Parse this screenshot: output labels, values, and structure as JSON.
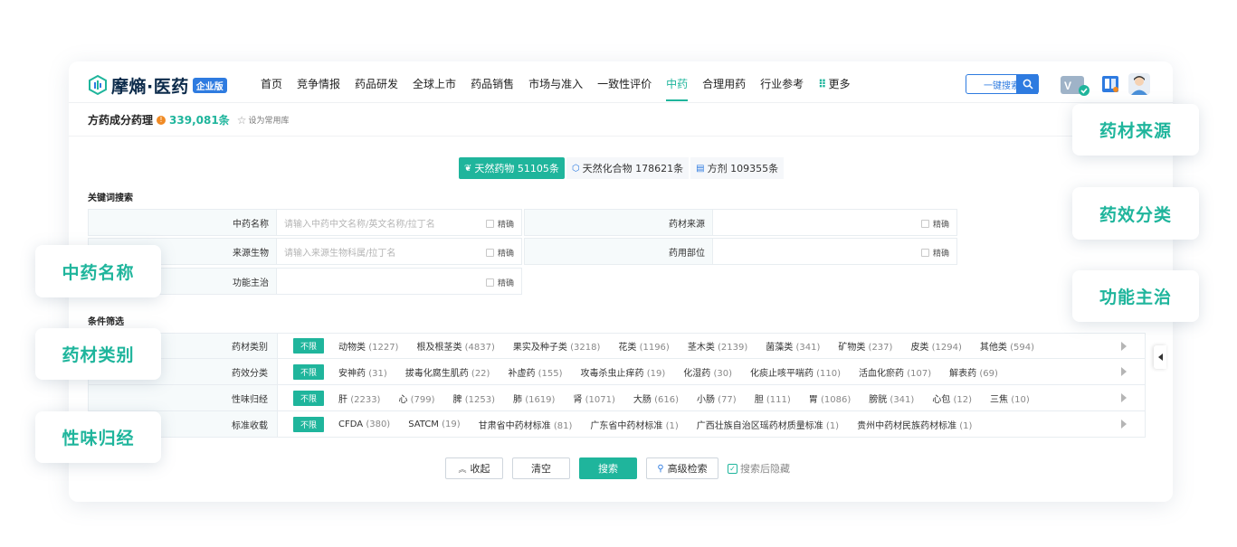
{
  "brand": {
    "name": "摩熵·医药",
    "badge": "企业版"
  },
  "nav": {
    "items": [
      "首页",
      "竞争情报",
      "药品研发",
      "全球上市",
      "药品销售",
      "市场与准入",
      "一致性评价",
      "中药",
      "合理用药",
      "行业参考"
    ],
    "active_index": 7,
    "more_label": "更多"
  },
  "header_search": {
    "label": "一键搜索"
  },
  "page": {
    "title": "方药成分药理",
    "count": "339,081条",
    "favorite_label": "设为常用库"
  },
  "tabs": [
    {
      "label": "天然药物 51105条",
      "active": true
    },
    {
      "label": "天然化合物 178621条",
      "active": false
    },
    {
      "label": "方剂 109355条",
      "active": false
    }
  ],
  "keyword_section": {
    "title": "关键词搜索",
    "exact_label": "精确",
    "fields": {
      "tcm_name": {
        "label": "中药名称",
        "placeholder": "请输入中药中文名称/英文名称/拉丁名"
      },
      "herb_source": {
        "label": "药材来源",
        "placeholder": ""
      },
      "source_organism": {
        "label": "来源生物",
        "placeholder": "请输入来源生物科属/拉丁名"
      },
      "medicinal_part": {
        "label": "药用部位",
        "placeholder": ""
      },
      "function": {
        "label": "功能主治",
        "placeholder": ""
      }
    }
  },
  "filter_section": {
    "title": "条件筛选",
    "unlimited_label": "不限",
    "rows": [
      {
        "label": "药材类别",
        "items": [
          {
            "name": "动物类",
            "count": "(1227)"
          },
          {
            "name": "根及根茎类",
            "count": "(4837)"
          },
          {
            "name": "果实及种子类",
            "count": "(3218)"
          },
          {
            "name": "花类",
            "count": "(1196)"
          },
          {
            "name": "茎木类",
            "count": "(2139)"
          },
          {
            "name": "菌藻类",
            "count": "(341)"
          },
          {
            "name": "矿物类",
            "count": "(237)"
          },
          {
            "name": "皮类",
            "count": "(1294)"
          },
          {
            "name": "其他类",
            "count": "(594)"
          }
        ]
      },
      {
        "label": "药效分类",
        "items": [
          {
            "name": "安神药",
            "count": "(31)"
          },
          {
            "name": "拔毒化腐生肌药",
            "count": "(22)"
          },
          {
            "name": "补虚药",
            "count": "(155)"
          },
          {
            "name": "攻毒杀虫止痒药",
            "count": "(19)"
          },
          {
            "name": "化湿药",
            "count": "(30)"
          },
          {
            "name": "化痰止咳平喘药",
            "count": "(110)"
          },
          {
            "name": "活血化瘀药",
            "count": "(107)"
          },
          {
            "name": "解表药",
            "count": "(69)"
          }
        ]
      },
      {
        "label": "性味归经",
        "items": [
          {
            "name": "肝",
            "count": "(2233)"
          },
          {
            "name": "心",
            "count": "(799)"
          },
          {
            "name": "脾",
            "count": "(1253)"
          },
          {
            "name": "肺",
            "count": "(1619)"
          },
          {
            "name": "肾",
            "count": "(1071)"
          },
          {
            "name": "大肠",
            "count": "(616)"
          },
          {
            "name": "小肠",
            "count": "(77)"
          },
          {
            "name": "胆",
            "count": "(111)"
          },
          {
            "name": "胃",
            "count": "(1086)"
          },
          {
            "name": "膀胱",
            "count": "(341)"
          },
          {
            "name": "心包",
            "count": "(12)"
          },
          {
            "name": "三焦",
            "count": "(10)"
          }
        ]
      },
      {
        "label": "标准收载",
        "items": [
          {
            "name": "CFDA",
            "count": "(380)"
          },
          {
            "name": "SATCM",
            "count": "(19)"
          },
          {
            "name": "甘肃省中药材标准",
            "count": "(81)"
          },
          {
            "name": "广东省中药材标准",
            "count": "(1)"
          },
          {
            "name": "广西壮族自治区瑶药材质量标准",
            "count": "(1)"
          },
          {
            "name": "贵州中药材民族药材标准",
            "count": "(1)"
          }
        ]
      }
    ]
  },
  "actions": {
    "collapse": "收起",
    "clear": "清空",
    "search": "搜索",
    "advanced": "高级检索",
    "hide_after_search": "搜索后隐藏"
  },
  "callouts": {
    "right": [
      "药材来源",
      "药效分类",
      "功能主治"
    ],
    "left": [
      "中药名称",
      "药材类别",
      "性味归经"
    ]
  },
  "colors": {
    "accent": "#1fb59c",
    "brand_blue": "#2e7be0",
    "info_orange": "#f08a24"
  }
}
